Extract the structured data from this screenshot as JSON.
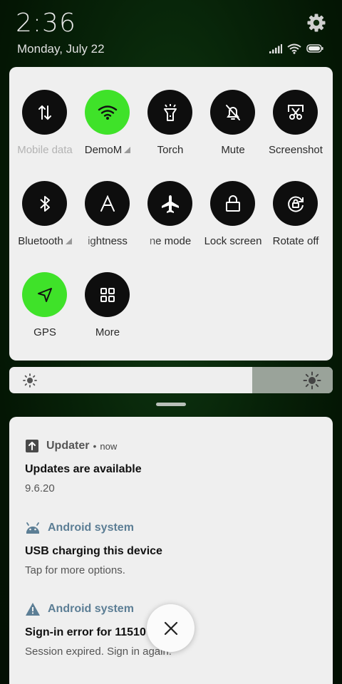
{
  "status": {
    "time": "2:36",
    "date": "Monday, July 22"
  },
  "quick_tiles": [
    {
      "label": "Mobile data",
      "icon": "mobile-data-icon",
      "active": false,
      "dim": true
    },
    {
      "label": "DemoM",
      "icon": "wifi-icon",
      "active": true,
      "dim": false,
      "expand": true
    },
    {
      "label": "Torch",
      "icon": "torch-icon",
      "active": false,
      "dim": false
    },
    {
      "label": "Mute",
      "icon": "mute-bell-icon",
      "active": false,
      "dim": false
    },
    {
      "label": "Screenshot",
      "icon": "screenshot-icon",
      "active": false,
      "dim": false
    },
    {
      "label": "Bluetooth",
      "icon": "bluetooth-icon",
      "active": false,
      "dim": false,
      "expand": true
    },
    {
      "label": "ightness",
      "icon": "auto-brightness-icon",
      "active": false,
      "dim": false
    },
    {
      "label": "ne mode",
      "icon": "airplane-icon",
      "active": false,
      "dim": false
    },
    {
      "label": "Lock screen",
      "icon": "lock-icon",
      "active": false,
      "dim": false
    },
    {
      "label": "Rotate off",
      "icon": "rotate-lock-icon",
      "active": false,
      "dim": false
    },
    {
      "label": "GPS",
      "icon": "gps-icon",
      "active": true,
      "dim": false
    },
    {
      "label": "More",
      "icon": "grid-icon",
      "active": false,
      "dim": false
    }
  ],
  "brightness": {
    "level": 0.75
  },
  "notifications": [
    {
      "app": "Updater",
      "time": "now",
      "icon": "updater-arrow-icon",
      "title": "Updates are available",
      "text": "9.6.20"
    },
    {
      "app": "Android system",
      "time": "",
      "icon": "android-icon",
      "title": "USB charging this device",
      "text": "Tap for more options."
    },
    {
      "app": "Android system",
      "time": "",
      "icon": "warning-icon",
      "title": "Sign-in error for 11510",
      "text": "Session expired. Sign in again."
    }
  ],
  "colors": {
    "accent_on": "#3fe229",
    "tile_off": "#0e0e0e",
    "app_blue": "#5c7e95"
  }
}
